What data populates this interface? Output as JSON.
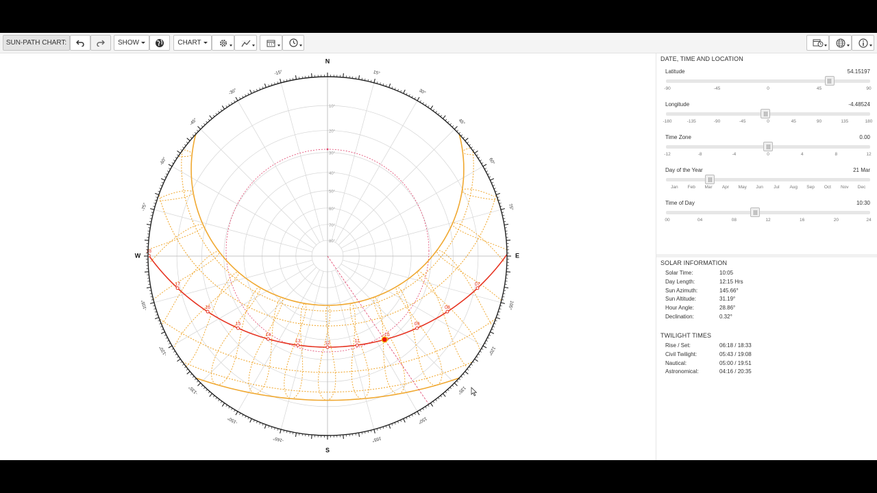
{
  "toolbar": {
    "title_button": "SUN-PATH CHART:",
    "undo_icon": "undo-icon",
    "redo_icon": "redo-icon",
    "show_label": "SHOW",
    "globe_icon": "globe-icon",
    "chart_label": "CHART",
    "settings_icon": "gear-icon",
    "chart_style_icon": "chart-style-icon",
    "calendar_icon": "calendar-icon",
    "clock_icon": "clock-icon",
    "right_icons": [
      "calendar-clock-icon",
      "globe-icon",
      "info-icon"
    ]
  },
  "chart": {
    "compass": {
      "north": "N",
      "south": "S",
      "east": "E",
      "west": "W"
    },
    "azimuth_labels": [
      {
        "az": -15,
        "text": "-15°"
      },
      {
        "az": 15,
        "text": "15°"
      },
      {
        "az": -30,
        "text": "-30°"
      },
      {
        "az": 30,
        "text": "30°"
      },
      {
        "az": -45,
        "text": "-45°"
      },
      {
        "az": 45,
        "text": "45°"
      },
      {
        "az": -60,
        "text": "-60°"
      },
      {
        "az": 60,
        "text": "60°"
      },
      {
        "az": -75,
        "text": "-75°"
      },
      {
        "az": 75,
        "text": "75°"
      },
      {
        "az": -105,
        "text": "-105°"
      },
      {
        "az": 105,
        "text": "105°"
      },
      {
        "az": -120,
        "text": "-120°"
      },
      {
        "az": 120,
        "text": "120°"
      },
      {
        "az": -135,
        "text": "-135°"
      },
      {
        "az": 135,
        "text": "135°"
      },
      {
        "az": -150,
        "text": "-150°"
      },
      {
        "az": 150,
        "text": "150°"
      },
      {
        "az": -165,
        "text": "-165°"
      },
      {
        "az": 165,
        "text": "165°"
      }
    ],
    "altitude_labels": [
      "10°",
      "20°",
      "30°",
      "40°",
      "50°",
      "60°",
      "70°",
      "80°"
    ],
    "hour_labels": [
      "18",
      "17",
      "16",
      "15",
      "14",
      "13",
      "12",
      "11",
      "10",
      "09",
      "08",
      "07"
    ],
    "colors": {
      "sun_path": "#e63422",
      "analemma": "#f0a830",
      "ring": "#222222",
      "grid": "#d4d4d4",
      "sun": "#ee1111",
      "horizon_guide": "#e0406a"
    },
    "sun_position": {
      "azimuth": 145.66,
      "altitude": 31.19
    }
  },
  "sidebar": {
    "location_title": "DATE, TIME AND LOCATION",
    "sliders": [
      {
        "label": "Latitude",
        "value": "54.15197",
        "fraction": 0.8009,
        "ticks": [
          "-90",
          "-45",
          "0",
          "45",
          "90"
        ]
      },
      {
        "label": "Longitude",
        "value": "-4.48524",
        "fraction": 0.4875,
        "ticks": [
          "-180",
          "-135",
          "-90",
          "-45",
          "0",
          "45",
          "90",
          "135",
          "180"
        ]
      },
      {
        "label": "Time Zone",
        "value": "0.00",
        "fraction": 0.5,
        "ticks": [
          "-12",
          "-8",
          "-4",
          "0",
          "4",
          "8",
          "12"
        ]
      },
      {
        "label": "Day of the Year",
        "value": "21 Mar",
        "fraction": 0.2164,
        "ticks": [
          "Jan",
          "Feb",
          "Mar",
          "Apr",
          "May",
          "Jun",
          "Jul",
          "Aug",
          "Sep",
          "Oct",
          "Nov",
          "Dec"
        ]
      },
      {
        "label": "Time of Day",
        "value": "10:30",
        "fraction": 0.4375,
        "ticks": [
          "00",
          "04",
          "08",
          "12",
          "16",
          "20",
          "24"
        ]
      }
    ],
    "solar_title": "SOLAR INFORMATION",
    "solar": [
      {
        "key": "Solar Time:",
        "value": "10:05"
      },
      {
        "key": "Day Length:",
        "value": "12:15 Hrs"
      },
      {
        "key": "Sun Azimuth:",
        "value": "145.66°"
      },
      {
        "key": "Sun Altitude:",
        "value": "31.19°"
      },
      {
        "key": "Hour Angle:",
        "value": "28.86°"
      },
      {
        "key": "Declination:",
        "value": "0.32°"
      }
    ],
    "twilight_title": "TWILIGHT TIMES",
    "twilight": [
      {
        "key": "Rise / Set:",
        "value": "06:18 / 18:33"
      },
      {
        "key": "Civil Twilight:",
        "value": "05:43 / 19:08"
      },
      {
        "key": "Nautical:",
        "value": "05:00 / 19:51"
      },
      {
        "key": "Astronomical:",
        "value": "04:16 / 20:35"
      }
    ]
  }
}
